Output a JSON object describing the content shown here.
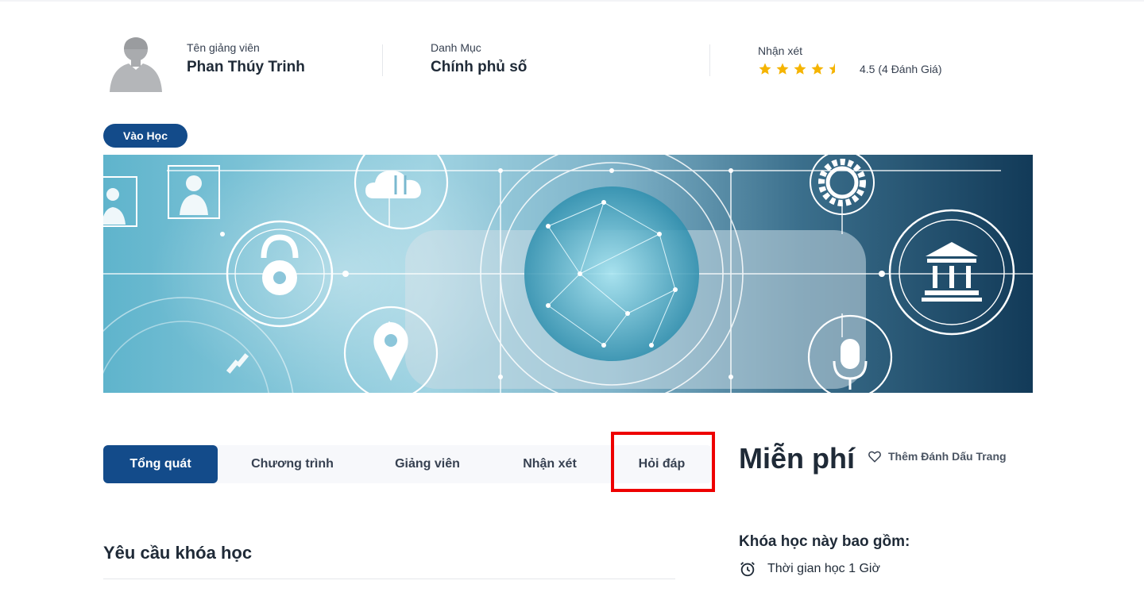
{
  "instructor": {
    "label": "Tên giảng viên",
    "name": "Phan Thúy Trinh"
  },
  "category": {
    "label": "Danh Mục",
    "value": "Chính phủ số"
  },
  "review": {
    "label": "Nhận xét",
    "rating": 4.5,
    "max_stars": 5,
    "summary": "4.5 (4 Đánh Giá)"
  },
  "enroll_button": "Vào Học",
  "banner": {
    "icons": [
      "person-icon",
      "person-icon",
      "cloud-sync-icon",
      "lock-icon",
      "globe-network-icon",
      "location-pin-icon",
      "gear-icon",
      "bank-icon",
      "microphone-icon"
    ]
  },
  "tabs": [
    {
      "label": "Tổng quát",
      "active": true
    },
    {
      "label": "Chương trình",
      "active": false
    },
    {
      "label": "Giảng viên",
      "active": false
    },
    {
      "label": "Nhận xét",
      "active": false
    },
    {
      "label": "Hỏi đáp",
      "active": false,
      "highlighted": true
    }
  ],
  "price": "Miễn phí",
  "bookmark": {
    "label": "Thêm Đánh Dấu Trang",
    "icon": "heart-icon"
  },
  "course_includes": {
    "title": "Khóa học này bao gồm:",
    "items": [
      {
        "icon": "alarm-clock-icon",
        "text": "Thời gian học 1 Giờ"
      }
    ]
  },
  "requirements": {
    "title": "Yêu cầu khóa học"
  },
  "colors": {
    "primary": "#134b8a",
    "star": "#f5b400",
    "highlight": "#ee0000",
    "tab_bg": "#f7f8fb"
  }
}
